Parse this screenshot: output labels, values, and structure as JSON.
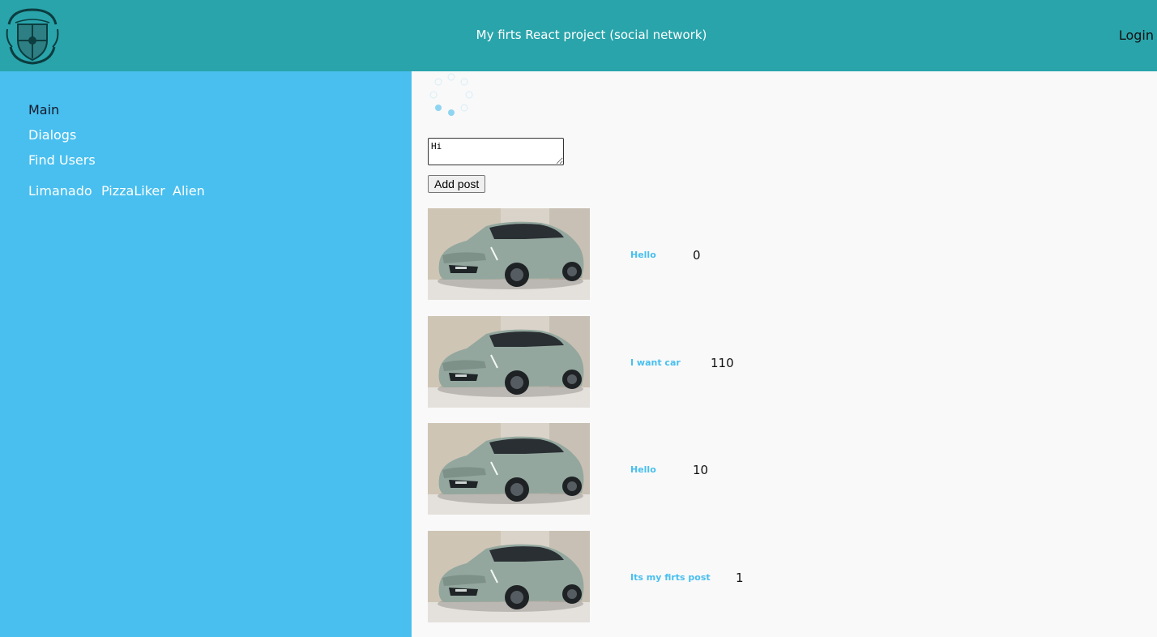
{
  "header": {
    "title": "My firts React project (social network)",
    "login_label": "Login"
  },
  "sidebar": {
    "nav": [
      {
        "label": "Main"
      },
      {
        "label": "Dialogs"
      },
      {
        "label": "Find Users"
      }
    ],
    "friends": [
      {
        "name": "Limanado"
      },
      {
        "name": "PizzaLiker"
      },
      {
        "name": "Alien"
      }
    ]
  },
  "composer": {
    "text_value": "Hi",
    "button_label": "Add post"
  },
  "posts": [
    {
      "message": "Hello",
      "likes": "0"
    },
    {
      "message": "I want car",
      "likes": "110"
    },
    {
      "message": "Hello",
      "likes": "10"
    },
    {
      "message": "Its my firts post",
      "likes": "1"
    }
  ],
  "colors": {
    "header_bg": "#29a4ab",
    "sidebar_bg": "#48bfef",
    "content_bg": "#f9f9f9",
    "post_text": "#48bfef"
  },
  "icons": {
    "logo": "hogwarts-crest-icon",
    "loader": "loading-spinner-icon"
  }
}
